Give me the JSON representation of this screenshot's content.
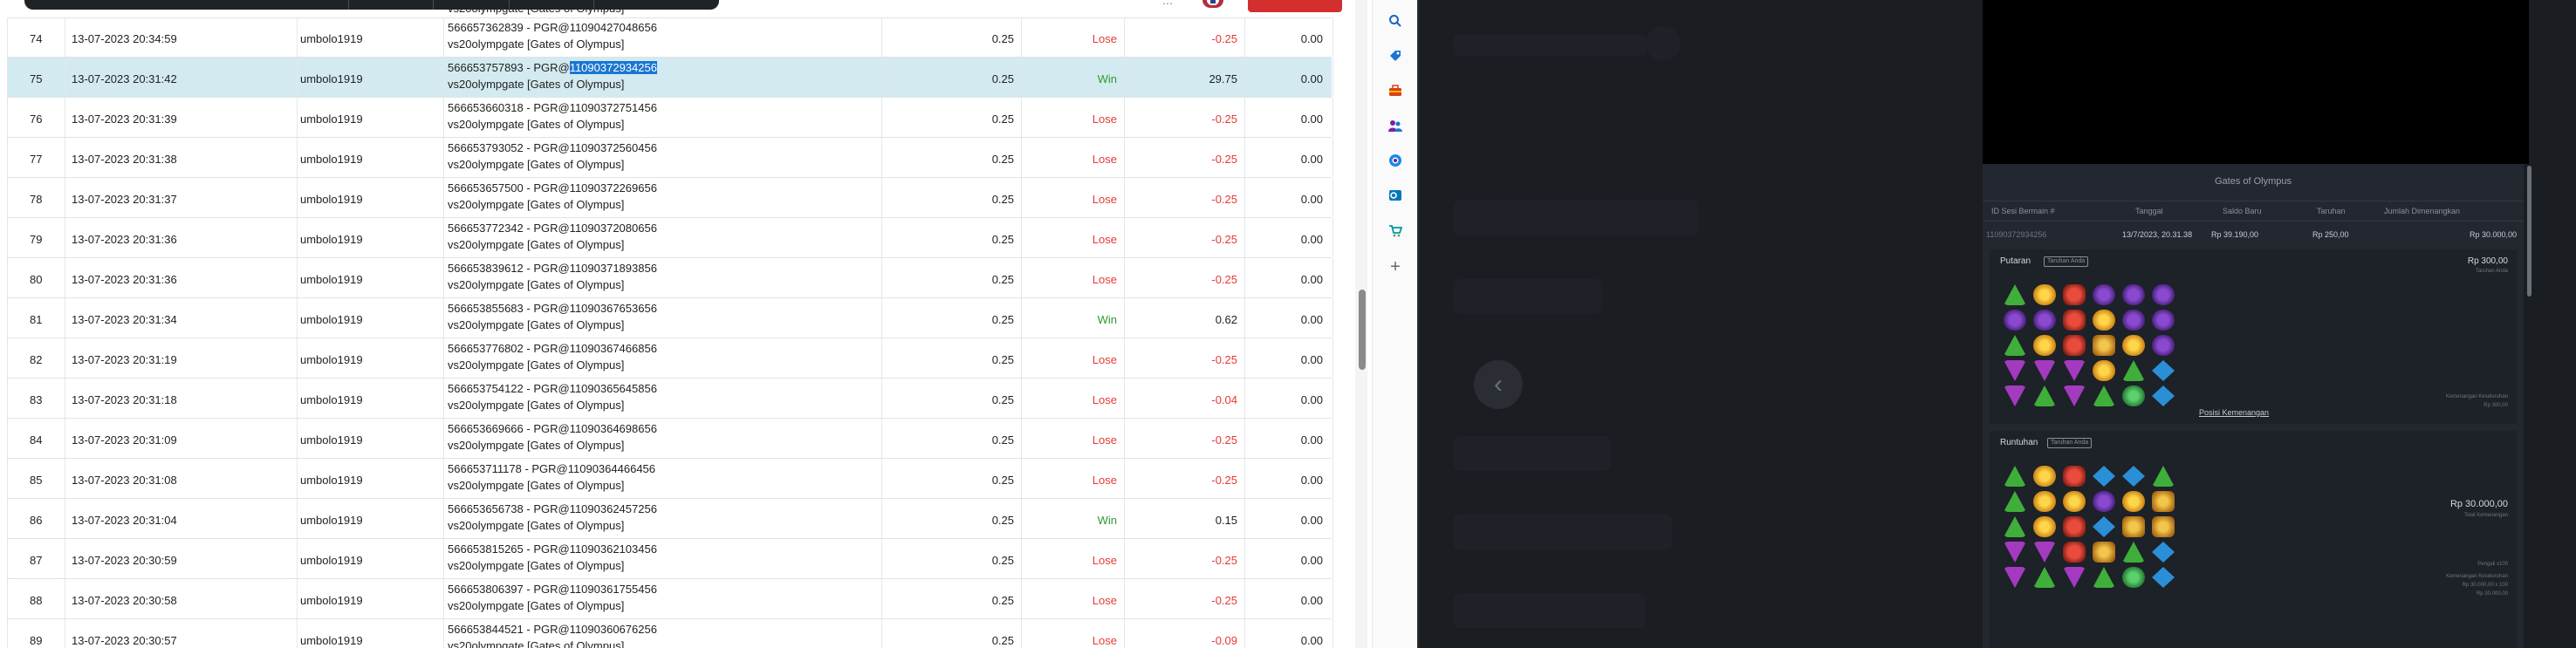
{
  "table": {
    "rows": [
      {
        "no": "74",
        "datetime": "13-07-2023 20:34:59",
        "user": "umbolo1919",
        "game_line1": "566657362839 - PGR@11090427048656",
        "game_line2": "vs20olympgate [Gates of Olympus]",
        "stake": "0.25",
        "result": "Lose",
        "win": "-0.25",
        "balance": "0.00"
      },
      {
        "no": "75",
        "datetime": "13-07-2023 20:31:42",
        "user": "umbolo1919",
        "game_prefix": "566653757893 - PGR@",
        "game_highlight": "11090372934256",
        "game_line2": "vs20olympgate [Gates of Olympus]",
        "stake": "0.25",
        "result": "Win",
        "win": "29.75",
        "balance": "0.00"
      },
      {
        "no": "76",
        "datetime": "13-07-2023 20:31:39",
        "user": "umbolo1919",
        "game_line1": "566653660318 - PGR@11090372751456",
        "game_line2": "vs20olympgate [Gates of Olympus]",
        "stake": "0.25",
        "result": "Lose",
        "win": "-0.25",
        "balance": "0.00"
      },
      {
        "no": "77",
        "datetime": "13-07-2023 20:31:38",
        "user": "umbolo1919",
        "game_line1": "566653793052 - PGR@11090372560456",
        "game_line2": "vs20olympgate [Gates of Olympus]",
        "stake": "0.25",
        "result": "Lose",
        "win": "-0.25",
        "balance": "0.00"
      },
      {
        "no": "78",
        "datetime": "13-07-2023 20:31:37",
        "user": "umbolo1919",
        "game_line1": "566653657500 - PGR@11090372269656",
        "game_line2": "vs20olympgate [Gates of Olympus]",
        "stake": "0.25",
        "result": "Lose",
        "win": "-0.25",
        "balance": "0.00"
      },
      {
        "no": "79",
        "datetime": "13-07-2023 20:31:36",
        "user": "umbolo1919",
        "game_line1": "566653772342 - PGR@11090372080656",
        "game_line2": "vs20olympgate [Gates of Olympus]",
        "stake": "0.25",
        "result": "Lose",
        "win": "-0.25",
        "balance": "0.00"
      },
      {
        "no": "80",
        "datetime": "13-07-2023 20:31:36",
        "user": "umbolo1919",
        "game_line1": "566653839612 - PGR@11090371893856",
        "game_line2": "vs20olympgate [Gates of Olympus]",
        "stake": "0.25",
        "result": "Lose",
        "win": "-0.25",
        "balance": "0.00"
      },
      {
        "no": "81",
        "datetime": "13-07-2023 20:31:34",
        "user": "umbolo1919",
        "game_line1": "566653855683 - PGR@11090367653656",
        "game_line2": "vs20olympgate [Gates of Olympus]",
        "stake": "0.25",
        "result": "Win",
        "win": "0.62",
        "balance": "0.00"
      },
      {
        "no": "82",
        "datetime": "13-07-2023 20:31:19",
        "user": "umbolo1919",
        "game_line1": "566653776802 - PGR@11090367466856",
        "game_line2": "vs20olympgate [Gates of Olympus]",
        "stake": "0.25",
        "result": "Lose",
        "win": "-0.25",
        "balance": "0.00"
      },
      {
        "no": "83",
        "datetime": "13-07-2023 20:31:18",
        "user": "umbolo1919",
        "game_line1": "566653754122 - PGR@11090365645856",
        "game_line2": "vs20olympgate [Gates of Olympus]",
        "stake": "0.25",
        "result": "Lose",
        "win": "-0.04",
        "balance": "0.00"
      },
      {
        "no": "84",
        "datetime": "13-07-2023 20:31:09",
        "user": "umbolo1919",
        "game_line1": "566653669666 - PGR@11090364698656",
        "game_line2": "vs20olympgate [Gates of Olympus]",
        "stake": "0.25",
        "result": "Lose",
        "win": "-0.25",
        "balance": "0.00"
      },
      {
        "no": "85",
        "datetime": "13-07-2023 20:31:08",
        "user": "umbolo1919",
        "game_line1": "566653711178 - PGR@11090364466456",
        "game_line2": "vs20olympgate [Gates of Olympus]",
        "stake": "0.25",
        "result": "Lose",
        "win": "-0.25",
        "balance": "0.00"
      },
      {
        "no": "86",
        "datetime": "13-07-2023 20:31:04",
        "user": "umbolo1919",
        "game_line1": "566653656738 - PGR@11090362457256",
        "game_line2": "vs20olympgate [Gates of Olympus]",
        "stake": "0.25",
        "result": "Win",
        "win": "0.15",
        "balance": "0.00"
      },
      {
        "no": "87",
        "datetime": "13-07-2023 20:30:59",
        "user": "umbolo1919",
        "game_line1": "566653815265 - PGR@11090362103456",
        "game_line2": "vs20olympgate [Gates of Olympus]",
        "stake": "0.25",
        "result": "Lose",
        "win": "-0.25",
        "balance": "0.00"
      },
      {
        "no": "88",
        "datetime": "13-07-2023 20:30:58",
        "user": "umbolo1919",
        "game_line1": "566653806397 - PGR@11090361755456",
        "game_line2": "vs20olympgate [Gates of Olympus]",
        "stake": "0.25",
        "result": "Lose",
        "win": "-0.25",
        "balance": "0.00"
      },
      {
        "no": "89",
        "datetime": "13-07-2023 20:30:57",
        "user": "umbolo1919",
        "game_line1": "566653844521 - PGR@11090360676256",
        "game_line2": "vs20olympgate [Gates of Olympus]",
        "stake": "0.25",
        "result": "Lose",
        "win": "-0.09",
        "balance": "0.00"
      }
    ],
    "partial_top_line2": "vs20olympgate [Gates of Olympus]"
  },
  "sidebar_icons": [
    "search-icon",
    "tag-icon",
    "briefcase-icon",
    "people-icon",
    "office-icon",
    "outlook-icon",
    "cart-icon",
    "plus-icon"
  ],
  "colors": {
    "lose": "#e53935",
    "win": "#2e9b2e",
    "highlight": "#1976d2",
    "selected_row": "#d3eaf1"
  },
  "panel": {
    "title": "Gates of Olympus",
    "headers": [
      "ID Sesi Bermain #",
      "Tanggal",
      "Saldo Baru",
      "Taruhan",
      "Jumlah Dimenangkan"
    ],
    "values": [
      "11090372934256",
      "13/7/2023, 20.31.38",
      "Rp 39.190,00",
      "Rp 250,00",
      "Rp 30.000,00"
    ],
    "putaran": {
      "title": "Putaran",
      "badge": "Taruhan Anda",
      "amount": "Rp 300,00",
      "amount_sub": "Taruhan Anda",
      "small1": "Kemenangan Keseluruhan",
      "small2": "Rp 300,00",
      "link": "Posisi Kemenangan"
    },
    "runtuhan": {
      "title": "Runtuhan",
      "badge": "Taruhan Anda",
      "amount": "Rp 30.000,00",
      "amount_sub": "Total Kemenangan",
      "small1": "Pengali x100",
      "small2": "Kemenangan Keseluruhan",
      "small3": "Rp 30.000,00 x 100",
      "small4": "Rp 30.000,00"
    }
  },
  "reels": {
    "putaran": [
      [
        "g",
        "o",
        "r",
        "v",
        "v",
        "v"
      ],
      [
        "v",
        "v",
        "r",
        "o",
        "v",
        "v"
      ],
      [
        "g",
        "o",
        "r",
        "y",
        "o",
        "v"
      ],
      [
        "p",
        "p",
        "p",
        "o",
        "g",
        "b"
      ],
      [
        "p",
        "g",
        "p",
        "g",
        "gc",
        "b"
      ]
    ],
    "runtuhan": [
      [
        "g",
        "o",
        "r",
        "b",
        "b",
        "g"
      ],
      [
        "g",
        "o",
        "o",
        "v",
        "o",
        "y"
      ],
      [
        "g",
        "o",
        "r",
        "b",
        "y",
        "y"
      ],
      [
        "p",
        "p",
        "r",
        "y",
        "g",
        "b"
      ],
      [
        "p",
        "g",
        "p",
        "g",
        "gc",
        "b"
      ]
    ]
  }
}
